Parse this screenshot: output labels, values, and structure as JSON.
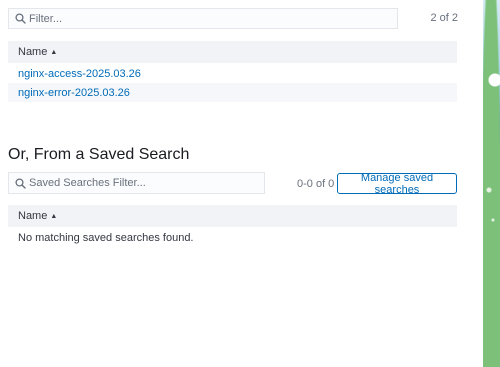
{
  "index_list": {
    "filter": {
      "placeholder": "Filter...",
      "value": "",
      "icon": "search-icon"
    },
    "pager_text": "2 of 2",
    "column_header": "Name",
    "sort_indicator": "▲",
    "rows": [
      {
        "name": "nginx-access-2025.03.26"
      },
      {
        "name": "nginx-error-2025.03.26"
      }
    ]
  },
  "saved_search": {
    "title": "Or, From a Saved Search",
    "filter": {
      "placeholder": "Saved Searches Filter...",
      "value": "",
      "icon": "search-icon"
    },
    "pager_text": "0-0 of 0",
    "manage_button_label": "Manage saved searches",
    "column_header": "Name",
    "sort_indicator": "▲",
    "empty_message": "No matching saved searches found."
  },
  "colors": {
    "link": "#006bb8",
    "header_bg": "#f1f3f6",
    "text": "#343741",
    "muted": "#69707d"
  }
}
